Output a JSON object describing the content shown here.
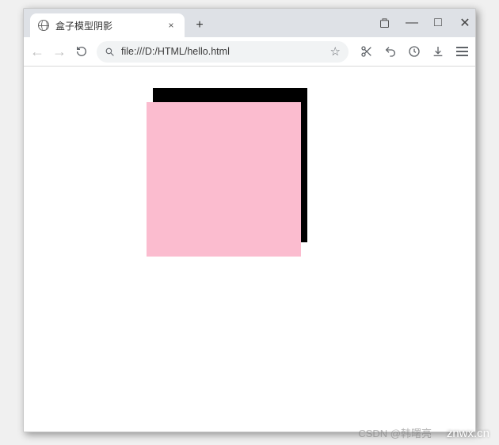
{
  "tab": {
    "title": "盒子模型阴影",
    "close": "×"
  },
  "newTab": "+",
  "windowControls": {
    "minimize": "—",
    "maximize": "□",
    "close": "✕"
  },
  "toolbar": {
    "url": "file:///D:/HTML/hello.html",
    "star": "☆"
  },
  "box": {
    "color": "#fbbccf",
    "shadowColor": "#000000"
  },
  "watermark": {
    "brand": "znwx.cn",
    "csdn": "CSDN @韩曙亮"
  }
}
